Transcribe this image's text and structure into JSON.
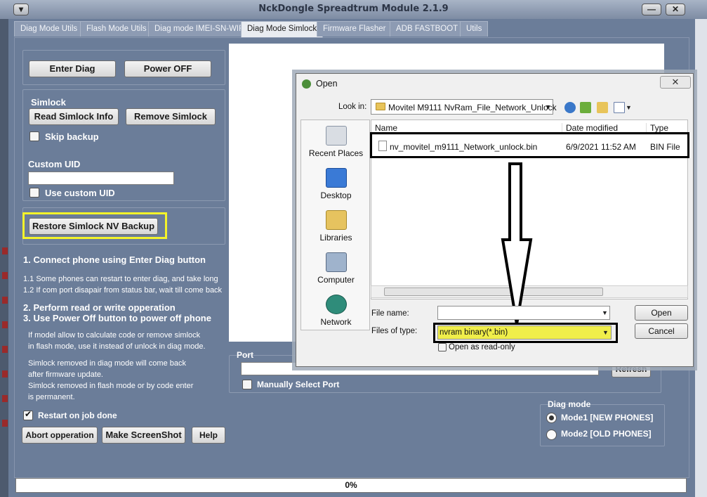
{
  "window": {
    "title": "NckDongle Spreadtrum Module 2.1.9",
    "sysmenu_glyph": "▾",
    "min_glyph": "—",
    "close_glyph": "✕"
  },
  "tabs": [
    {
      "label": "Diag Mode Utils"
    },
    {
      "label": "Flash Mode Utils"
    },
    {
      "label": "Diag mode IMEI-SN-WIFI"
    },
    {
      "label": "Diag Mode Simlock"
    },
    {
      "label": "Firmware Flasher"
    },
    {
      "label": "ADB FASTBOOT"
    },
    {
      "label": "Utils"
    }
  ],
  "diag_buttons": {
    "enter_diag": "Enter Diag",
    "power_off": "Power OFF"
  },
  "simlock": {
    "group_label": "Simlock",
    "read_info": "Read Simlock Info",
    "remove": "Remove Simlock",
    "skip_backup": "Skip backup",
    "custom_uid_label": "Custom UID",
    "custom_uid_value": "",
    "use_custom_uid": "Use custom UID"
  },
  "restore_button": "Restore Simlock NV Backup",
  "instructions": {
    "step1": "1. Connect phone using Enter Diag button",
    "step1_note1": "1.1 Some phones can restart to enter diag, and take long",
    "step1_note2": "1.2 If com port disapair from status bar, wait till come back",
    "step2": "2. Perform read or write opperation",
    "step3": "3. Use Power Off button to power off phone",
    "para1_line1": "If model allow to calculate code or remove simlock",
    "para1_line2": "in flash mode, use it instead of unlock in diag mode.",
    "para2_line1": "Simlock removed in diag mode will come back",
    "para2_line2": "after firmware update.",
    "para2_line3": "Simlock removed in flash mode or by code enter",
    "para2_line4": "is permanent."
  },
  "restart_on_job_done": "Restart on job done",
  "bottom_buttons": {
    "abort": "Abort opperation",
    "screenshot": "Make ScreenShot",
    "help": "Help"
  },
  "port": {
    "label": "Port",
    "refresh": "Refresh",
    "manual": "Manually Select Port"
  },
  "diag_mode": {
    "label": "Diag mode",
    "mode1": "Mode1  [NEW PHONES]",
    "mode2": "Mode2 [OLD PHONES]",
    "selected": "mode1"
  },
  "progress": {
    "text": "0%",
    "value": 0
  },
  "dialog": {
    "title": "Open",
    "close_glyph": "✕",
    "look_in_label": "Look in:",
    "look_in_value": "Movitel M9111 NvRam_File_Network_Unlock",
    "places": [
      "Recent Places",
      "Desktop",
      "Libraries",
      "Computer",
      "Network"
    ],
    "columns": {
      "name": "Name",
      "date": "Date modified",
      "type": "Type"
    },
    "files": [
      {
        "name": "nv_movitel_m9111_Network_unlock.bin",
        "date": "6/9/2021 11:52 AM",
        "type": "BIN File"
      }
    ],
    "file_name_label": "File name:",
    "file_name_value": "",
    "files_of_type_label": "Files of type:",
    "files_of_type_value": "nvram binary(*.bin)",
    "read_only": "Open as read-only",
    "open_button": "Open",
    "cancel_button": "Cancel"
  },
  "colors": {
    "highlight_yellow": "#f4f32a",
    "annotation_black": "#000000"
  }
}
